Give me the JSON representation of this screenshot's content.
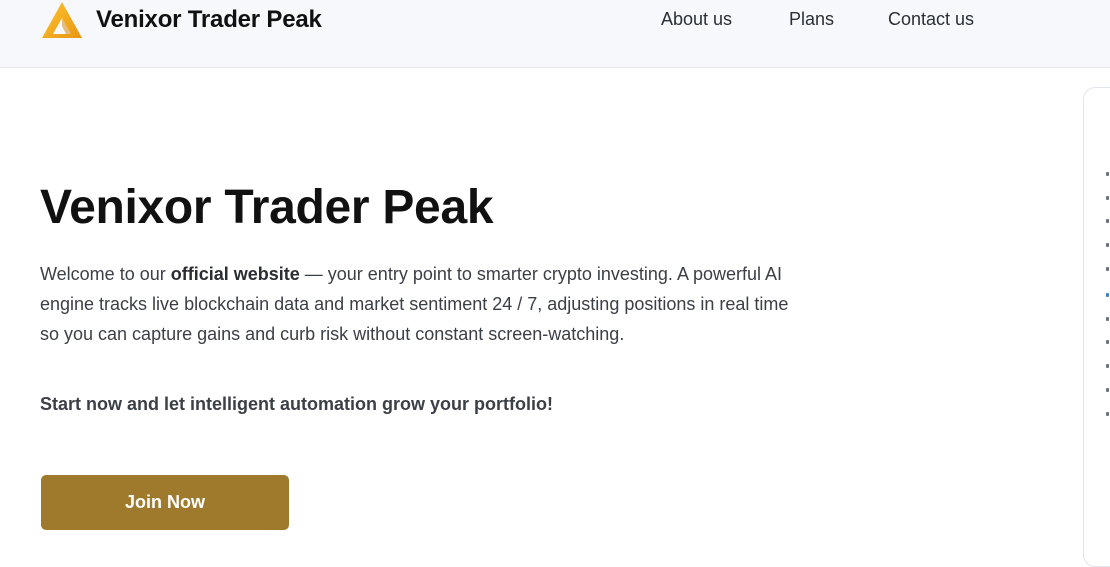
{
  "header": {
    "brand_name": "Venixor Trader Peak",
    "nav": [
      {
        "label": "About us"
      },
      {
        "label": "Plans"
      },
      {
        "label": "Contact us"
      }
    ]
  },
  "hero": {
    "title": "Venixor Trader Peak",
    "intro_before": "Welcome to our ",
    "intro_bold": "official website",
    "intro_after": " — your entry point to smarter crypto investing. A powerful AI engine tracks live blockchain data and market sentiment 24 / 7, adjusting positions in real time so you can capture gains and curb risk without constant screen-watching.",
    "cta_text": "Start now and let intelligent automation grow your portfolio!",
    "button_label": "Join Now"
  },
  "colors": {
    "accent": "#a07a2c",
    "logo_gold": "#f2a81d",
    "header_bg": "#f6f8fb"
  },
  "icons": {
    "logo": "triangle-logo-icon"
  }
}
